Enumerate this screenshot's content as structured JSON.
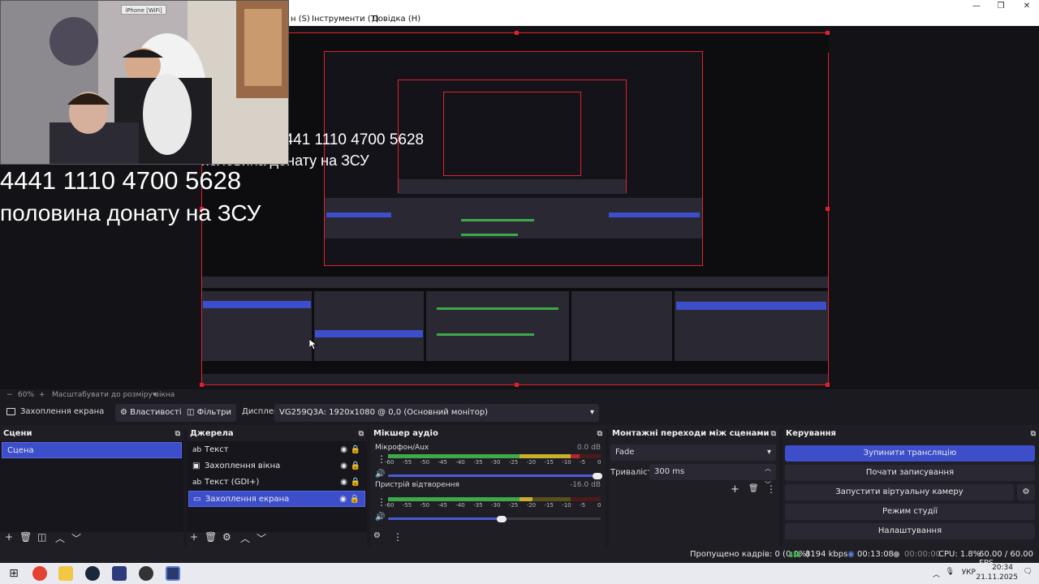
{
  "menu": {
    "items": [
      "н (S)",
      "Інструменти (T)",
      "Довідка (H)"
    ]
  },
  "webcam": {
    "device_label": "iPhone [WiFi]"
  },
  "overlay": {
    "card_number": "4441 1110 4700 5628",
    "donation_text": "половина донату на ЗСУ"
  },
  "zoom": {
    "minus": "−",
    "level": "60%",
    "plus": "+",
    "fit_label": "Масштабувати до розміру вікна"
  },
  "sourcebar": {
    "source_name": "Захоплення екрана",
    "properties": "Властивості",
    "filters": "Фільтри",
    "display_label": "Дисплей",
    "display_value": "VG259Q3A: 1920x1080 @ 0,0 (Основний монітор)"
  },
  "scenes": {
    "title": "Сцени",
    "items": [
      "Сцена"
    ]
  },
  "sources": {
    "title": "Джерела",
    "items": [
      {
        "name": "Текст",
        "icon": "text-icon"
      },
      {
        "name": "Захоплення вікна",
        "icon": "window-icon"
      },
      {
        "name": "Текст (GDI+)",
        "icon": "text-icon"
      },
      {
        "name": "Захоплення екрана",
        "icon": "monitor-icon"
      }
    ]
  },
  "mixer": {
    "title": "Мікшер аудіо",
    "channels": [
      {
        "name": "Мікрофон/Aux",
        "db": "0.0 dB",
        "level": 0.9,
        "volume": 1.0
      },
      {
        "name": "Пристрій відтворення",
        "db": "-16.0 dB",
        "level": 0.68,
        "volume": 0.55
      }
    ],
    "scale": [
      "-60",
      "-55",
      "-50",
      "-45",
      "-40",
      "-35",
      "-30",
      "-25",
      "-20",
      "-15",
      "-10",
      "-5",
      "0"
    ]
  },
  "transitions": {
    "title": "Монтажні переходи між сценами",
    "selected": "Fade",
    "duration_label": "Тривалість",
    "duration_value": "300 ms"
  },
  "controls": {
    "title": "Керування",
    "stop_stream": "Зупинити трансляцію",
    "start_recording": "Почати записування",
    "start_vcam": "Запустити віртуальну камеру",
    "studio_mode": "Режим студії",
    "settings": "Налаштування"
  },
  "status": {
    "dropped": "Пропущено кадрів: 0 (0.0%)",
    "bitrate": "8194 kbps",
    "stream_time": "00:13:08",
    "rec_time": "00:00:00",
    "cpu": "CPU: 1.8%",
    "fps": "60.00 / 60.00 FPS"
  },
  "taskbar": {
    "lang": "УКР",
    "time": "20:34",
    "date": "21.11.2025"
  },
  "colors": {
    "accent": "#3d4ecb",
    "selection_border": "#e0202e",
    "meter_green": "#3da94a",
    "meter_yellow": "#c9b02a",
    "meter_red": "#b5262b"
  }
}
